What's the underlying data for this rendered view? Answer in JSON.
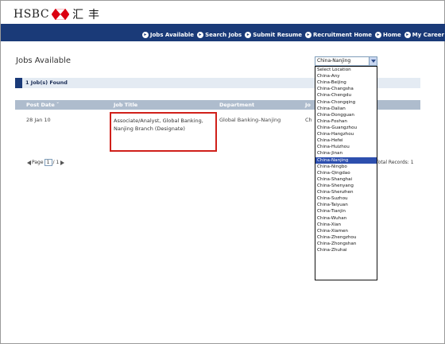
{
  "header": {
    "logo_text": "HSBC",
    "logo_chinese": "汇丰",
    "brand_colors": {
      "red": "#db0011",
      "navy": "#1a3a78"
    }
  },
  "nav": {
    "links": [
      "Jobs Available",
      "Search Jobs",
      "Submit Resume",
      "Recruitment Home",
      "Home",
      "My Career"
    ]
  },
  "main": {
    "title": "Jobs Available",
    "found": "1 Job(s) Found",
    "columns": [
      "Post Date",
      "Job Title",
      "Department",
      "Jo"
    ],
    "row": {
      "date": "28 Jan 10",
      "job_title": "Associate/Analyst, Global Banking, Nanjing Branch (Designate)",
      "department": "Global Banking–Nanjing",
      "location": "Ch"
    },
    "pager": {
      "label": "Page",
      "page": "1",
      "of": "/ 1"
    },
    "total": "Total Records: 1"
  },
  "location": {
    "selected": "China-Nanjing",
    "options": [
      "Select Location",
      "China-Any",
      "China-Beijing",
      "China-Changsha",
      "China-Chengdu",
      "China-Chongqing",
      "China-Dalian",
      "China-Dongguan",
      "China-Foshan",
      "China-Guangzhou",
      "China-Hangzhou",
      "China-Hefei",
      "China-Huizhou",
      "China-Jinan",
      "China-Nanjing",
      "China-Ningbo",
      "China-Qingdao",
      "China-Shanghai",
      "China-Shenyang",
      "China-Shenzhen",
      "China-Suzhou",
      "China-Taiyuan",
      "China-Tianjin",
      "China-Wuhan",
      "China-Xian",
      "China-Xiamen",
      "China-Zhengzhou",
      "China-Zhongshan",
      "China-Zhuhai"
    ]
  }
}
